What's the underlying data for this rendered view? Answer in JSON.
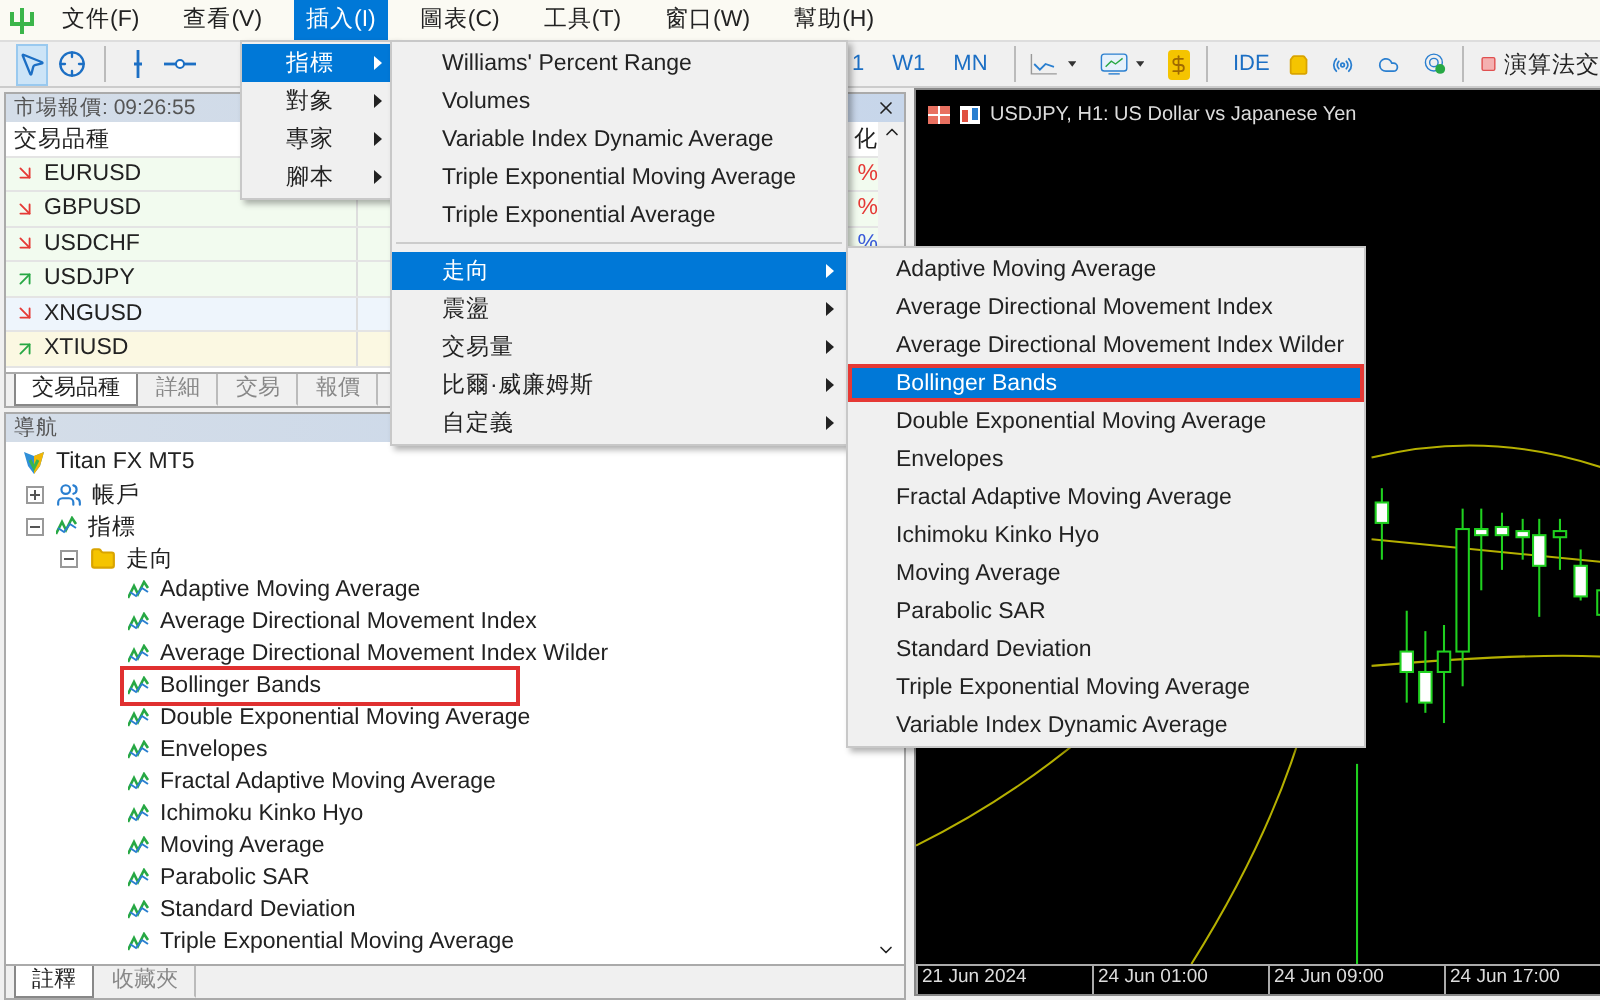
{
  "menu_bar": [
    {
      "label": "文件(F)",
      "selected": false
    },
    {
      "label": "查看(V)",
      "selected": false
    },
    {
      "label": "插入(I)",
      "selected": true
    },
    {
      "label": "圖表(C)",
      "selected": false
    },
    {
      "label": "工具(T)",
      "selected": false
    },
    {
      "label": "窗口(W)",
      "selected": false
    },
    {
      "label": "幫助(H)",
      "selected": false
    }
  ],
  "toolbar": {
    "drawing_tools": [
      {
        "kind": "pointer",
        "selected": true
      },
      {
        "kind": "crosshair",
        "selected": false
      },
      {
        "kind": "vline",
        "selected": false
      },
      {
        "kind": "hline",
        "selected": false
      }
    ],
    "timeframes": [
      "1",
      "W1",
      "MN"
    ],
    "ide": "IDE",
    "algo_trading": "演算法交"
  },
  "market_watch": {
    "title": "市場報價: 09:26:55",
    "column_1": "交易品種",
    "column_3": "化",
    "rows": [
      {
        "symbol": "EURUSD",
        "kind": "down",
        "change": "%",
        "color": "#e53935"
      },
      {
        "symbol": "GBPUSD",
        "kind": "down",
        "change": "%",
        "color": "#e53935"
      },
      {
        "symbol": "USDCHF",
        "kind": "down",
        "change": "%",
        "color": "#3a5bd9"
      },
      {
        "symbol": "USDJPY",
        "kind": "up"
      },
      {
        "symbol": "XNGUSD",
        "kind": "down"
      },
      {
        "symbol": "XTIUSD",
        "kind": "up"
      }
    ],
    "tabs": [
      {
        "label": "交易品種",
        "selected": true
      },
      {
        "label": "詳細",
        "selected": false
      },
      {
        "label": "交易",
        "selected": false
      },
      {
        "label": "報價",
        "selected": false
      }
    ]
  },
  "navigator": {
    "title": "導航",
    "tree": [
      {
        "label": "Titan FX MT5",
        "kind": "root",
        "children": [
          {
            "label": "帳戶",
            "kind": "accounts",
            "expanded": false
          },
          {
            "label": "指標",
            "kind": "indicators",
            "expanded": true,
            "children": [
              {
                "label": "走向",
                "kind": "folder",
                "expanded": true,
                "children": [
                  {
                    "label": "Adaptive Moving Average",
                    "kind": "indicator",
                    "marked": false
                  },
                  {
                    "label": "Average Directional Movement Index",
                    "kind": "indicator",
                    "marked": false
                  },
                  {
                    "label": "Average Directional Movement Index Wilder",
                    "kind": "indicator",
                    "marked": false
                  },
                  {
                    "label": "Bollinger Bands",
                    "kind": "indicator",
                    "marked": true
                  },
                  {
                    "label": "Double Exponential Moving Average",
                    "kind": "indicator",
                    "marked": false
                  },
                  {
                    "label": "Envelopes",
                    "kind": "indicator",
                    "marked": false
                  },
                  {
                    "label": "Fractal Adaptive Moving Average",
                    "kind": "indicator",
                    "marked": false
                  },
                  {
                    "label": "Ichimoku Kinko Hyo",
                    "kind": "indicator",
                    "marked": false
                  },
                  {
                    "label": "Moving Average",
                    "kind": "indicator",
                    "marked": false
                  },
                  {
                    "label": "Parabolic SAR",
                    "kind": "indicator",
                    "marked": false
                  },
                  {
                    "label": "Standard Deviation",
                    "kind": "indicator",
                    "marked": false
                  },
                  {
                    "label": "Triple Exponential Moving Average",
                    "kind": "indicator",
                    "marked": false
                  }
                ]
              }
            ]
          }
        ]
      }
    ],
    "tabs": [
      {
        "label": "註釋",
        "selected": true
      },
      {
        "label": "收藏夾",
        "selected": false
      }
    ]
  },
  "chart": {
    "title": "USDJPY, H1:  US Dollar vs Japanese Yen",
    "time_labels": [
      "21 Jun 2024",
      "24 Jun 01:00",
      "24 Jun 09:00",
      "24 Jun 17:00"
    ]
  },
  "insert_menu": {
    "items": [
      {
        "label": "指標",
        "selected": true
      },
      {
        "label": "對象",
        "selected": false
      },
      {
        "label": "專家",
        "selected": false
      },
      {
        "label": "腳本",
        "selected": false
      }
    ]
  },
  "indicator_menu": {
    "recent": [
      "Williams' Percent Range",
      "Volumes",
      "Variable Index Dynamic Average",
      "Triple Exponential Moving Average",
      "Triple Exponential Average"
    ],
    "categories": [
      {
        "label": "走向",
        "selected": true
      },
      {
        "label": "震盪",
        "selected": false
      },
      {
        "label": "交易量",
        "selected": false
      },
      {
        "label": "比爾·威廉姆斯",
        "selected": false
      },
      {
        "label": "自定義",
        "selected": false
      }
    ]
  },
  "trend_menu": {
    "items": [
      {
        "label": "Adaptive Moving Average",
        "selected": false,
        "marked": false
      },
      {
        "label": "Average Directional Movement Index",
        "selected": false,
        "marked": false
      },
      {
        "label": "Average Directional Movement Index Wilder",
        "selected": false,
        "marked": false
      },
      {
        "label": "Bollinger Bands",
        "selected": true,
        "marked": true
      },
      {
        "label": "Double Exponential Moving Average",
        "selected": false,
        "marked": false
      },
      {
        "label": "Envelopes",
        "selected": false,
        "marked": false
      },
      {
        "label": "Fractal Adaptive Moving Average",
        "selected": false,
        "marked": false
      },
      {
        "label": "Ichimoku Kinko Hyo",
        "selected": false,
        "marked": false
      },
      {
        "label": "Moving Average",
        "selected": false,
        "marked": false
      },
      {
        "label": "Parabolic SAR",
        "selected": false,
        "marked": false
      },
      {
        "label": "Standard Deviation",
        "selected": false,
        "marked": false
      },
      {
        "label": "Triple Exponential Moving Average",
        "selected": false,
        "marked": false
      },
      {
        "label": "Variable Index Dynamic Average",
        "selected": false,
        "marked": false
      }
    ]
  }
}
